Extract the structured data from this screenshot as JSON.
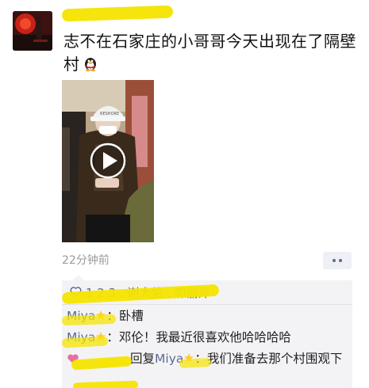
{
  "post": {
    "author_name": "",
    "text": "志不在石家庄的小哥哥今天出现在了隔壁村",
    "timestamp": "22分钟前"
  },
  "video": {
    "play_icon": "play-icon",
    "cap_text": "RESHORE"
  },
  "feedback": {
    "likes_text": "1 2 3 , 谢大佑 , 郭丽萍",
    "comments": [
      {
        "name": "Miya",
        "separator": "：",
        "text": "卧槽"
      },
      {
        "name": "Miya",
        "separator": "：",
        "text": "邓伦！我最近很喜欢他哈哈哈哈"
      },
      {
        "name": "",
        "reply_word": "回复",
        "reply_to": "Miya",
        "separator": "：",
        "text": "我们准备去那个村围观下"
      }
    ]
  },
  "colors": {
    "link": "#5b6b92",
    "highlight": "#f5e400",
    "timestamp": "#9a9a9a"
  },
  "icons": [
    "penguin-emoji-icon",
    "heart-icon",
    "star-icon",
    "more-icon"
  ]
}
